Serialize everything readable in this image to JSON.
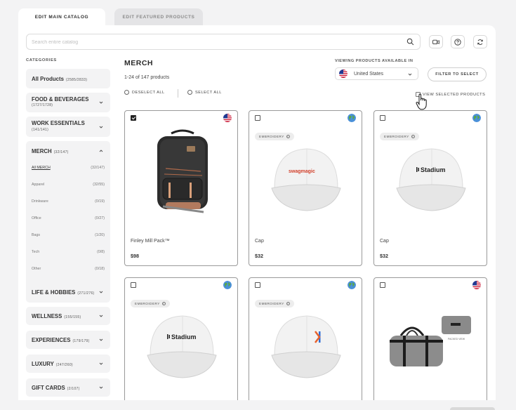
{
  "tabs": [
    {
      "label": "EDIT MAIN CATALOG",
      "active": true
    },
    {
      "label": "EDIT FEATURED PRODUCTS",
      "active": false
    }
  ],
  "search": {
    "placeholder": "Search entire catalog"
  },
  "toolbar_icons": [
    "video-icon",
    "help-icon",
    "refresh-icon"
  ],
  "sidebar": {
    "title": "CATEGORIES",
    "categories": [
      {
        "label": "All Products",
        "count": "(2585/2833)"
      },
      {
        "label": "FOOD & BEVERAGES",
        "count": "(1727/1728)"
      },
      {
        "label": "WORK ESSENTIALS",
        "count": "(141/141)"
      },
      {
        "label": "MERCH",
        "count": "(32/147)"
      },
      {
        "label": "LIFE & HOBBIES",
        "count": "(271/276)"
      },
      {
        "label": "WELLNESS",
        "count": "(155/155)"
      },
      {
        "label": "EXPERIENCES",
        "count": "(179/179)"
      },
      {
        "label": "LUXURY",
        "count": "(247/260)"
      },
      {
        "label": "GIFT CARDS",
        "count": "(2/107)"
      }
    ],
    "merch_subcategories": [
      {
        "label": "All MERCH",
        "count": "(32/147)"
      },
      {
        "label": "Apparel",
        "count": "(32/55)"
      },
      {
        "label": "Drinkware",
        "count": "(0/19)"
      },
      {
        "label": "Office",
        "count": "(0/27)"
      },
      {
        "label": "Bags",
        "count": "(1/20)"
      },
      {
        "label": "Tech",
        "count": "(0/8)"
      },
      {
        "label": "Other",
        "count": "(0/18)"
      }
    ]
  },
  "main": {
    "title": "MERCH",
    "product_count": "1-24 of 147 products",
    "deselect_all": "DESELECT ALL",
    "select_all": "SELECT ALL",
    "viewing_label": "VIEWING PRODUCTS AVAILABLE IN",
    "country": "United States",
    "filter_button": "FILTER TO SELECT",
    "view_selected": "VIEW SELECTED PRODUCTS"
  },
  "products": [
    {
      "name": "Finley Mill Pack™",
      "price": "$98",
      "checked": true,
      "region": "us-flag",
      "badge": ""
    },
    {
      "name": "Cap",
      "price": "$32",
      "checked": false,
      "region": "globe",
      "badge": "EMBROIDERY",
      "logo_text": "swagmagic"
    },
    {
      "name": "Cap",
      "price": "$32",
      "checked": false,
      "region": "globe",
      "badge": "EMBROIDERY",
      "logo_text": "Stadium"
    },
    {
      "name": "",
      "price": "",
      "checked": false,
      "region": "globe",
      "badge": "EMBROIDERY",
      "logo_text": "Stadium"
    },
    {
      "name": "",
      "price": "",
      "checked": false,
      "region": "globe",
      "badge": "EMBROIDERY",
      "logo_text": ""
    },
    {
      "name": "",
      "price": "",
      "checked": false,
      "region": "us-flag",
      "badge": "",
      "image_caption": "PACKED VIEW"
    }
  ],
  "colors": {
    "accent_orange": "#e8622c",
    "accent_blue": "#2f6fd6",
    "card_border": "#9a9a9a",
    "background": "#f3f3f4"
  }
}
